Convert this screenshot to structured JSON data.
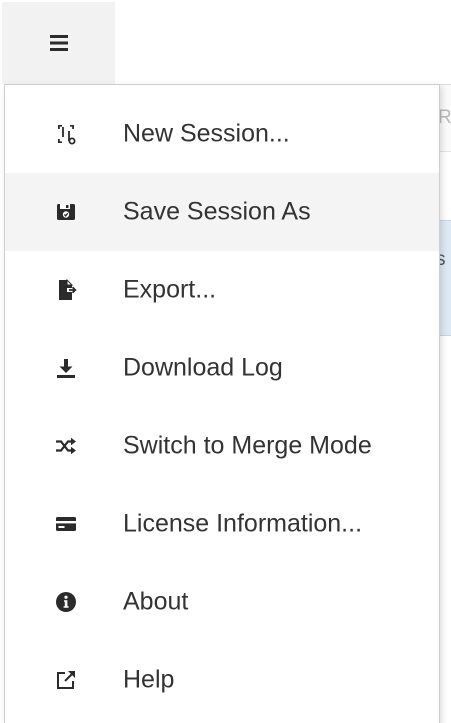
{
  "menu": {
    "trigger_icon": "hamburger-icon",
    "items": [
      {
        "label": "New Session...",
        "icon": "new-session-icon",
        "highlighted": false
      },
      {
        "label": "Save Session As",
        "icon": "save-session-icon",
        "highlighted": true
      },
      {
        "label": "Export...",
        "icon": "export-file-icon",
        "highlighted": false
      },
      {
        "label": "Download Log",
        "icon": "download-icon",
        "highlighted": false
      },
      {
        "label": "Switch to Merge Mode",
        "icon": "shuffle-icon",
        "highlighted": false
      },
      {
        "label": "License Information...",
        "icon": "credit-card-icon",
        "highlighted": false
      },
      {
        "label": "About",
        "icon": "info-circle-icon",
        "highlighted": false
      },
      {
        "label": "Help",
        "icon": "external-link-icon",
        "highlighted": false
      }
    ]
  },
  "background": {
    "fragment_1_text": "R A",
    "fragment_2_text": "s"
  },
  "colors": {
    "icon": "#2b2b2b",
    "text": "#333333",
    "highlight": "#f4f4f4",
    "trigger_bg": "#f2f2f2"
  }
}
